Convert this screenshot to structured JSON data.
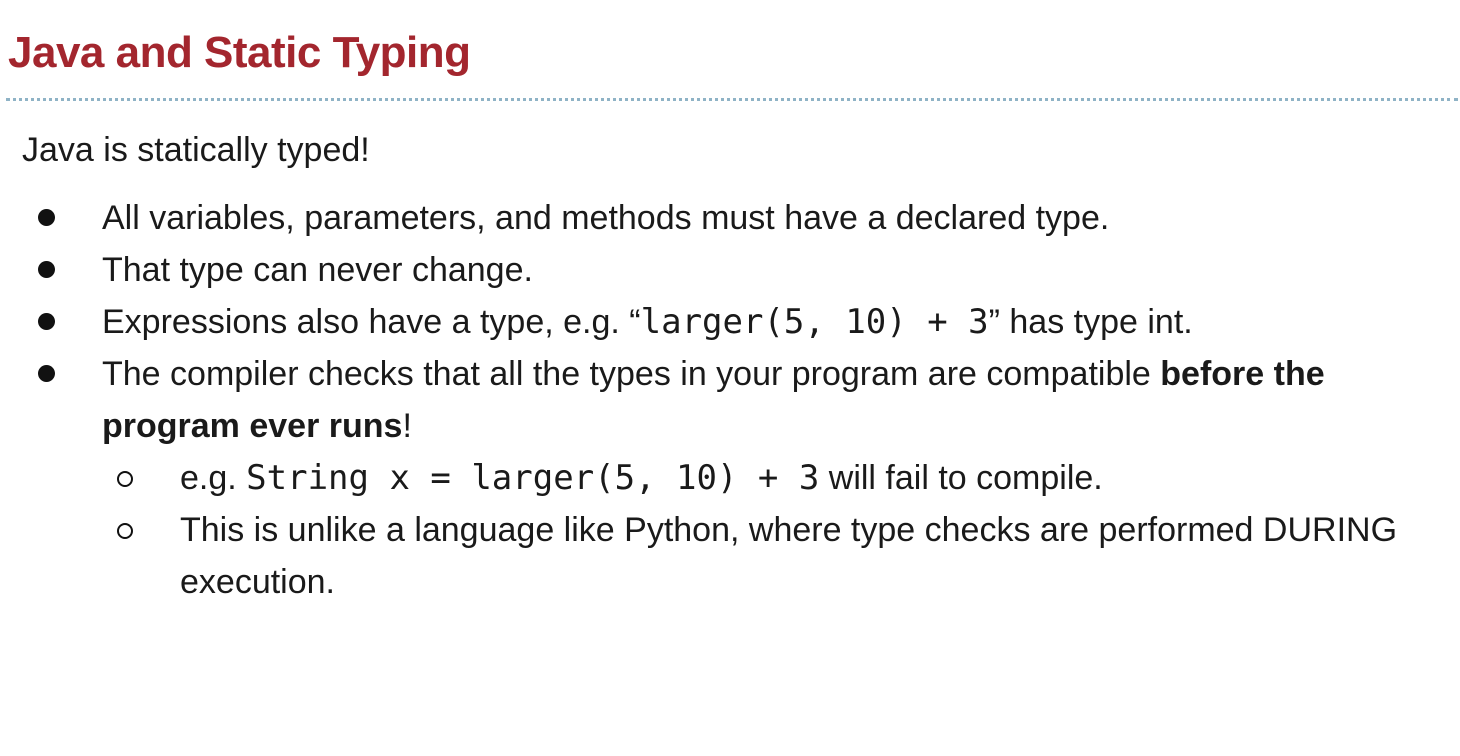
{
  "title": "Java and Static Typing",
  "intro": "Java is statically typed!",
  "bullets": {
    "b1": "All variables, parameters, and methods must have a declared type.",
    "b2": "That type can never change.",
    "b3": {
      "pre": "Expressions also have a type, e.g. “",
      "code": "larger(5, 10) + 3",
      "post": "” has type int."
    },
    "b4": {
      "pre": "The compiler checks that all the types in your program are compatible ",
      "bold": "before the program ever runs",
      "post": "!",
      "sub1": {
        "pre": "e.g. ",
        "code": "String x = larger(5, 10) + 3",
        "post": " will fail to compile."
      },
      "sub2": "This is unlike a language like Python, where type checks are performed DURING execution."
    }
  },
  "icons": {
    "bullet": "filled-circle-bullet-icon",
    "sub_bullet": "hollow-circle-bullet-icon"
  },
  "colors": {
    "title": "#a3262e",
    "divider": "#8fb3c6",
    "text": "#1a1a1a"
  }
}
